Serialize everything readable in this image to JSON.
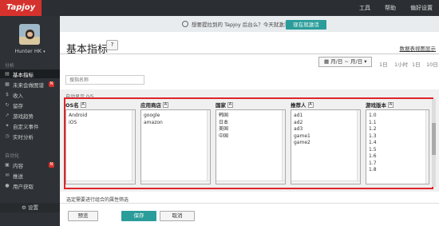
{
  "brand": {
    "logo_text": "Tapjoy"
  },
  "topnav": {
    "tools": "工具",
    "help": "帮助",
    "prefs": "偏好设置"
  },
  "notice": {
    "text": "想要提拉到的 Tapjoy 后台么？今天就激活账户~",
    "button": "现在就激活"
  },
  "sidebar": {
    "username": "Hunter HK",
    "analysis_section": "分析",
    "automation_section": "自动化",
    "items": [
      {
        "label": "基本指标",
        "icon": "chart-icon",
        "active": true
      },
      {
        "label": "未来会做图谱",
        "icon": "grid-icon",
        "badge": "N"
      },
      {
        "label": "收入",
        "icon": "money-icon"
      },
      {
        "label": "留存",
        "icon": "retention-icon"
      },
      {
        "label": "游戏趋势",
        "icon": "trend-icon"
      },
      {
        "label": "自定义事件",
        "icon": "event-icon"
      },
      {
        "label": "实时分析",
        "icon": "clock-icon"
      },
      {
        "label": "内容",
        "icon": "content-icon",
        "badge": "N"
      },
      {
        "label": "推送",
        "icon": "push-icon"
      },
      {
        "label": "用户获取",
        "icon": "user-icon"
      }
    ],
    "settings": "设置"
  },
  "main": {
    "title": "基本指标",
    "help_label": "?",
    "example_link": "数据表视图显示",
    "date_range": "月/日 ~ 月/日",
    "ranges": [
      "1日",
      "1小时",
      "1日",
      "10日"
    ],
    "search_placeholder": "搜指名称"
  },
  "filters": {
    "title": "自动显示 0/5",
    "columns": [
      {
        "header": "OS名",
        "items": [
          "Android",
          "iOS"
        ]
      },
      {
        "header": "应用商店",
        "items": [
          "google",
          "amazon"
        ]
      },
      {
        "header": "国家",
        "items": [
          "韩国",
          "日本",
          "美国",
          "中国"
        ]
      },
      {
        "header": "推荐人",
        "items": [
          "ad1",
          "ad2",
          "ad3",
          "game1",
          "game2"
        ]
      },
      {
        "header": "游戏版本",
        "items": [
          "1.0",
          "1.1",
          "1.2",
          "1.3",
          "1.4",
          "1.5",
          "1.6",
          "1.7",
          "1.8"
        ]
      }
    ]
  },
  "footer": {
    "hint": "选定需要进行组合的属性筛选",
    "preview": "预览",
    "save": "保存",
    "cancel": "取消"
  }
}
